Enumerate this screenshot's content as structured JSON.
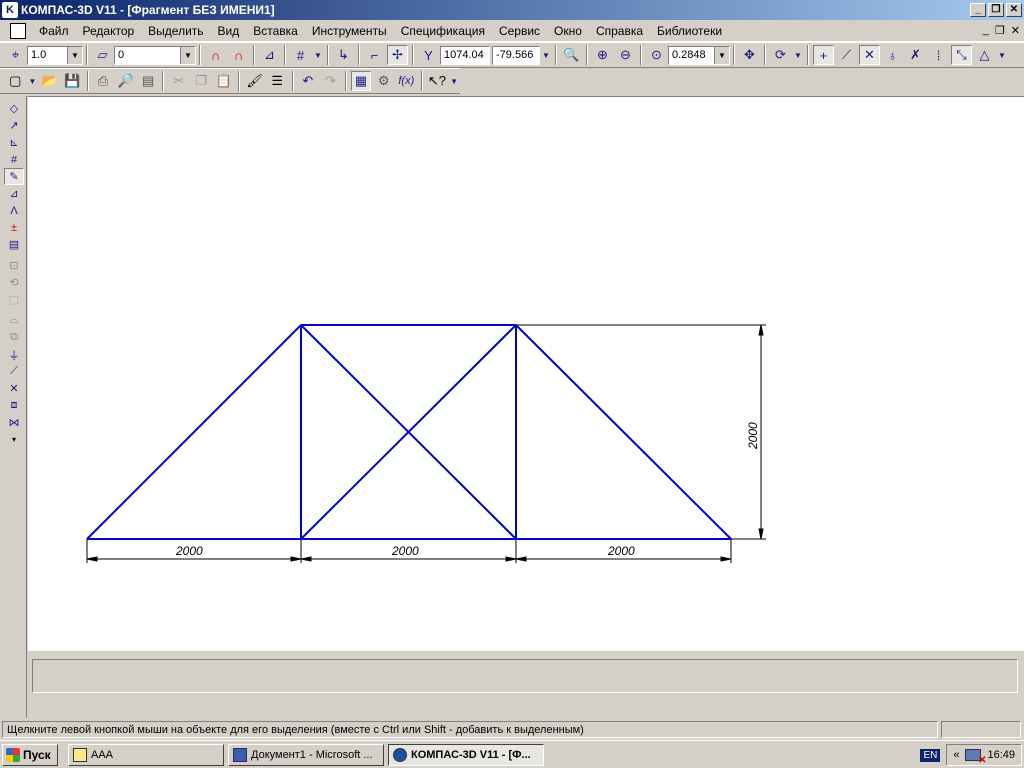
{
  "window": {
    "title": "КОМПАС-3D V11 - [Фрагмент БЕЗ ИМЕНИ1]",
    "minimize": "_",
    "restore": "❐",
    "close": "✕"
  },
  "menu": {
    "items": [
      "Файл",
      "Редактор",
      "Выделить",
      "Вид",
      "Вставка",
      "Инструменты",
      "Спецификация",
      "Сервис",
      "Окно",
      "Справка",
      "Библиотеки"
    ],
    "mdi_minimize": "_",
    "mdi_restore": "❐",
    "mdi_close": "✕"
  },
  "toolbar1": {
    "step_value": "1.0",
    "layer_value": "0",
    "coord_x": "1074.04",
    "coord_y": "-79.566",
    "zoom_value": "0.2848"
  },
  "drawing": {
    "dimension_labels": [
      "2000",
      "2000",
      "2000",
      "2000"
    ],
    "line_color": "#0000d8",
    "dim_color": "#000000"
  },
  "status": {
    "hint": "Щелкните левой кнопкой мыши на объекте для его выделения (вместе с Ctrl или Shift - добавить к выделенным)"
  },
  "taskbar": {
    "start_label": "Пуск",
    "tasks": [
      {
        "label": "AAA",
        "active": false
      },
      {
        "label": "Документ1 - Microsoft ...",
        "active": false
      },
      {
        "label": "КОМПАС-3D V11 - [Ф...",
        "active": true
      }
    ],
    "language": "EN",
    "clock": "16:49"
  }
}
